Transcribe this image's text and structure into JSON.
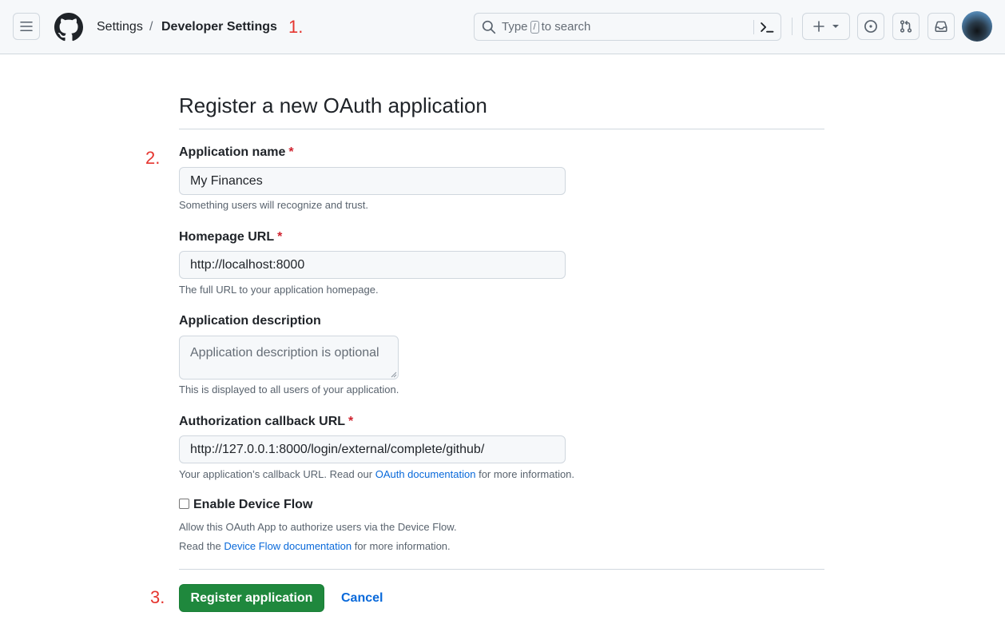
{
  "header": {
    "breadcrumb": [
      "Settings",
      "/",
      "Developer Settings"
    ],
    "search_prefix": "Type",
    "search_key": "/",
    "search_suffix": "to search",
    "icons": [
      "hamburger-icon",
      "github-logo-icon",
      "search-icon",
      "command-palette-icon",
      "plus-icon",
      "chevron-down-icon",
      "issues-icon",
      "pull-request-icon",
      "inbox-icon"
    ]
  },
  "annotations": [
    "1.",
    "2.",
    "3."
  ],
  "form": {
    "title": "Register a new OAuth application",
    "app_name_label": "Application name",
    "app_name_value": "My Finances",
    "app_name_note": "Something users will recognize and trust.",
    "homepage_label": "Homepage URL",
    "homepage_value": "http://localhost:8000",
    "homepage_note": "The full URL to your application homepage.",
    "description_label": "Application description",
    "description_placeholder": "Application description is optional",
    "description_note": "This is displayed to all users of your application.",
    "callback_label": "Authorization callback URL",
    "callback_value": "http://127.0.0.1:8000/login/external/complete/github/",
    "callback_note_prefix": "Your application’s callback URL. Read our",
    "callback_note_link": "OAuth documentation",
    "callback_note_suffix": "for more information.",
    "required_mark": "*",
    "device_flow_label": "Enable Device Flow",
    "device_flow_checked": false,
    "device_flow_note_1": "Allow this OAuth App to authorize users via the Device Flow.",
    "device_flow_note_2_prefix": "Read the",
    "device_flow_note_2_link": "Device Flow documentation",
    "device_flow_note_2_suffix": "for more information.",
    "register_button": "Register application",
    "cancel_link": "Cancel"
  },
  "colors": {
    "accent": "#0969da",
    "primary_button": "#1f883d",
    "required": "#cf222e",
    "annotation": "#e5352f"
  }
}
